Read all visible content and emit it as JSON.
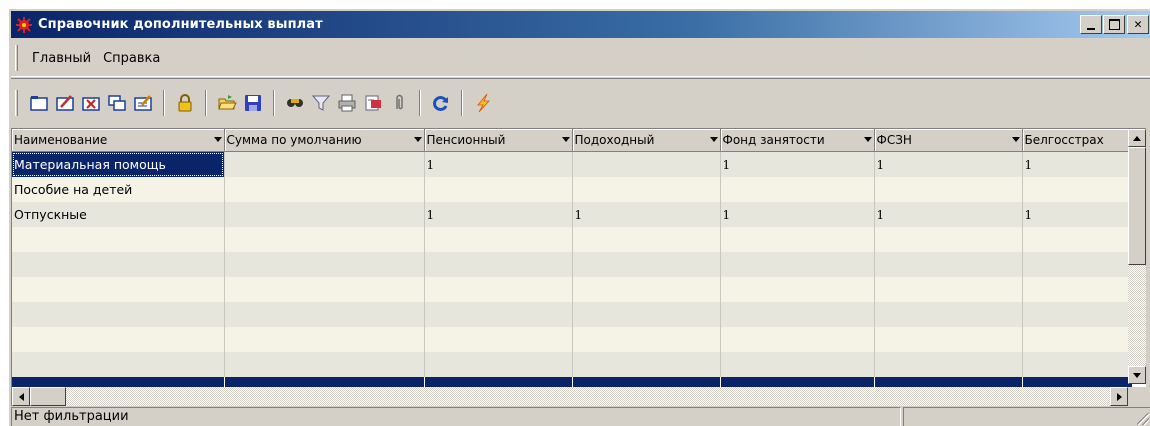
{
  "window": {
    "title": "Справочник дополнительных выплат",
    "title_gradient": [
      "#0a246a",
      "#a6caf0"
    ],
    "buttons": [
      "minimize",
      "maximize",
      "close"
    ]
  },
  "menu": {
    "items": [
      "Главный",
      "Справка"
    ]
  },
  "toolbar": {
    "icons": [
      "new-folder-icon",
      "edit-icon",
      "delete-icon",
      "copy-icon",
      "edit-list-icon",
      "lock-icon",
      "open-folder-icon",
      "save-icon",
      "find-icon",
      "filter-icon",
      "print-icon",
      "export-icon",
      "attach-icon",
      "refresh-icon",
      "lightning-icon"
    ]
  },
  "table": {
    "columns": [
      "Наименование",
      "Сумма по умолчанию",
      "Пенсионный",
      "Подоходный",
      "Фонд занятости",
      "ФСЗН",
      "Белгосстрах"
    ],
    "rows": [
      [
        "Материальная помощь",
        "",
        "1",
        "",
        "1",
        "1",
        "1"
      ],
      [
        "Пособие на детей",
        "",
        "",
        "",
        "",
        "",
        ""
      ],
      [
        "Отпускные",
        "",
        "1",
        "1",
        "1",
        "1",
        "1"
      ],
      [
        "",
        "",
        "",
        "",
        "",
        "",
        ""
      ],
      [
        "",
        "",
        "",
        "",
        "",
        "",
        ""
      ],
      [
        "",
        "",
        "",
        "",
        "",
        "",
        ""
      ],
      [
        "",
        "",
        "",
        "",
        "",
        "",
        ""
      ],
      [
        "",
        "",
        "",
        "",
        "",
        "",
        ""
      ],
      [
        "",
        "",
        "",
        "",
        "",
        "",
        ""
      ]
    ],
    "selected_row_color": "#0a246a",
    "row_colors": [
      "#e7e6dc",
      "#f5f2e6"
    ]
  },
  "status": {
    "left": "Нет фильтрации",
    "right": ""
  }
}
